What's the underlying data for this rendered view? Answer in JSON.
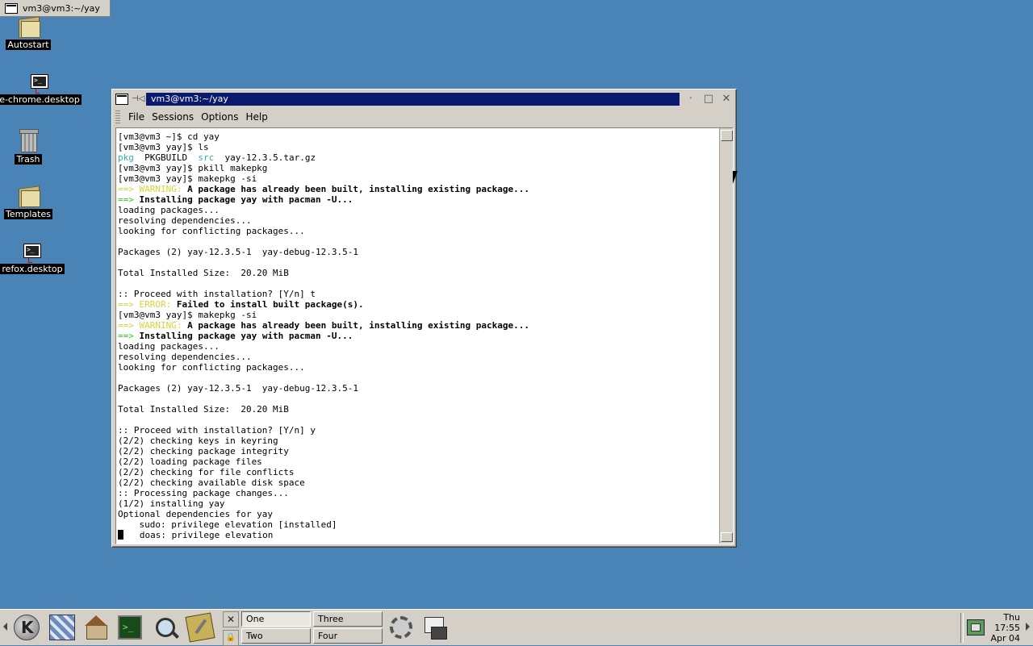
{
  "top_task": {
    "title": "vm3@vm3:~/yay"
  },
  "desktop_icons": [
    {
      "label": "Autostart",
      "icon": "folder-icon"
    },
    {
      "label": "e-chrome.desktop",
      "icon": "terminal-launcher-icon"
    },
    {
      "label": "Trash",
      "icon": "trash-icon"
    },
    {
      "label": "Templates",
      "icon": "folder-icon"
    },
    {
      "label": "refox.desktop",
      "icon": "terminal-launcher-icon"
    }
  ],
  "window": {
    "title": "vm3@vm3:~/yay",
    "menu": [
      "File",
      "Sessions",
      "Options",
      "Help"
    ],
    "terminal_lines": [
      [
        {
          "t": "[vm3@vm3 ~]$ cd yay"
        }
      ],
      [
        {
          "t": "[vm3@vm3 yay]$ ls"
        }
      ],
      [
        {
          "t": "pkg",
          "c": "c"
        },
        {
          "t": "  PKGBUILD  "
        },
        {
          "t": "src",
          "c": "c"
        },
        {
          "t": "  yay-12.3.5.tar.gz"
        }
      ],
      [
        {
          "t": "[vm3@vm3 yay]$ pkill makepkg"
        }
      ],
      [
        {
          "t": "[vm3@vm3 yay]$ makepkg -si"
        }
      ],
      [
        {
          "t": "==> WARNING:",
          "c": "y"
        },
        {
          "t": " A package has already been built, installing existing package...",
          "c": "b"
        }
      ],
      [
        {
          "t": "==>",
          "c": "g"
        },
        {
          "t": " Installing package yay with pacman -U...",
          "c": "b"
        }
      ],
      [
        {
          "t": "loading packages..."
        }
      ],
      [
        {
          "t": "resolving dependencies..."
        }
      ],
      [
        {
          "t": "looking for conflicting packages..."
        }
      ],
      [
        {
          "t": ""
        }
      ],
      [
        {
          "t": "Packages (2) yay-12.3.5-1  yay-debug-12.3.5-1"
        }
      ],
      [
        {
          "t": ""
        }
      ],
      [
        {
          "t": "Total Installed Size:  20.20 MiB"
        }
      ],
      [
        {
          "t": ""
        }
      ],
      [
        {
          "t": ":: Proceed with installation? [Y/n] t"
        }
      ],
      [
        {
          "t": "==> ERROR:",
          "c": "y"
        },
        {
          "t": " Failed to install built package(s).",
          "c": "b"
        }
      ],
      [
        {
          "t": "[vm3@vm3 yay]$ makepkg -si"
        }
      ],
      [
        {
          "t": "==> WARNING:",
          "c": "y"
        },
        {
          "t": " A package has already been built, installing existing package...",
          "c": "b"
        }
      ],
      [
        {
          "t": "==>",
          "c": "g"
        },
        {
          "t": " Installing package yay with pacman -U...",
          "c": "b"
        }
      ],
      [
        {
          "t": "loading packages..."
        }
      ],
      [
        {
          "t": "resolving dependencies..."
        }
      ],
      [
        {
          "t": "looking for conflicting packages..."
        }
      ],
      [
        {
          "t": ""
        }
      ],
      [
        {
          "t": "Packages (2) yay-12.3.5-1  yay-debug-12.3.5-1"
        }
      ],
      [
        {
          "t": ""
        }
      ],
      [
        {
          "t": "Total Installed Size:  20.20 MiB"
        }
      ],
      [
        {
          "t": ""
        }
      ],
      [
        {
          "t": ":: Proceed with installation? [Y/n] y"
        }
      ],
      [
        {
          "t": "(2/2) checking keys in keyring"
        }
      ],
      [
        {
          "t": "(2/2) checking package integrity"
        }
      ],
      [
        {
          "t": "(2/2) loading package files"
        }
      ],
      [
        {
          "t": "(2/2) checking for file conflicts"
        }
      ],
      [
        {
          "t": "(2/2) checking available disk space"
        }
      ],
      [
        {
          "t": ":: Processing package changes..."
        }
      ],
      [
        {
          "t": "(1/2) installing yay"
        }
      ],
      [
        {
          "t": "Optional dependencies for yay"
        }
      ],
      [
        {
          "t": "    sudo: privilege elevation [installed]"
        }
      ],
      [
        {
          "t": "    doas: privilege elevation"
        }
      ]
    ]
  },
  "panel": {
    "desktops": [
      "One",
      "Two",
      "Three",
      "Four"
    ],
    "active_desktop": "One",
    "clock": {
      "day": "Thu",
      "time": "17:55",
      "date": "Apr 04"
    }
  },
  "colors": {
    "desktop_bg": "#4a83b5",
    "titlebar_active": "#0a1a6e",
    "warning": "#d6d63a",
    "arrow": "#2bd12b"
  }
}
